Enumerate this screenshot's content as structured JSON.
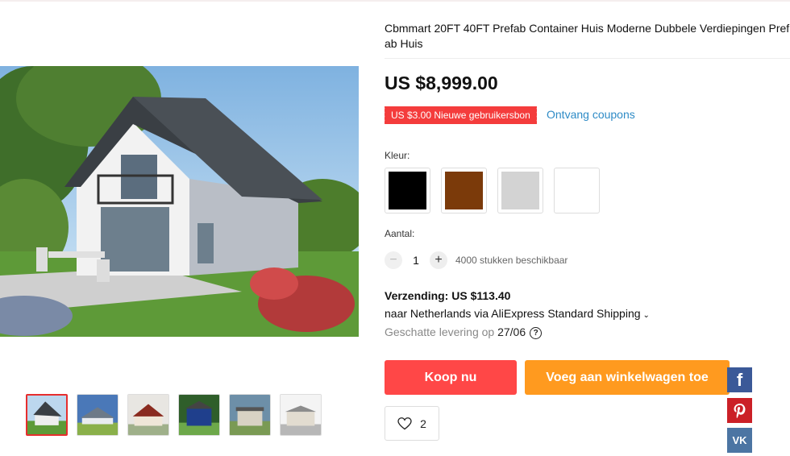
{
  "product": {
    "title": "Cbmmart 20FT 40FT Prefab Container Huis Moderne Dubbele Verdiepingen Prefab Huis",
    "price": "US $8,999.00",
    "coupon_badge": "US $3.00 Nieuwe gebruikersbon",
    "coupon_link": "Ontvang coupons"
  },
  "colors": {
    "label": "Kleur:",
    "swatches": [
      "#000000",
      "#7b3a0a",
      "#d3d3d3",
      "#ffffff"
    ]
  },
  "quantity": {
    "label": "Aantal:",
    "minus": "−",
    "plus": "+",
    "value": "1",
    "available": "4000 stukken beschikbaar"
  },
  "shipping": {
    "title": "Verzending: US $113.40",
    "route": "naar Netherlands via AliExpress Standard Shipping",
    "eta_prefix": "Geschatte levering op ",
    "eta_date": "27/06"
  },
  "actions": {
    "buy_now": "Koop nu",
    "add_to_cart": "Voeg aan winkelwagen toe",
    "wishlist_count": "2"
  },
  "social": {
    "facebook": "f",
    "vk": "VK"
  },
  "gallery": {
    "thumbnail_count": 6,
    "active_index": 0
  }
}
